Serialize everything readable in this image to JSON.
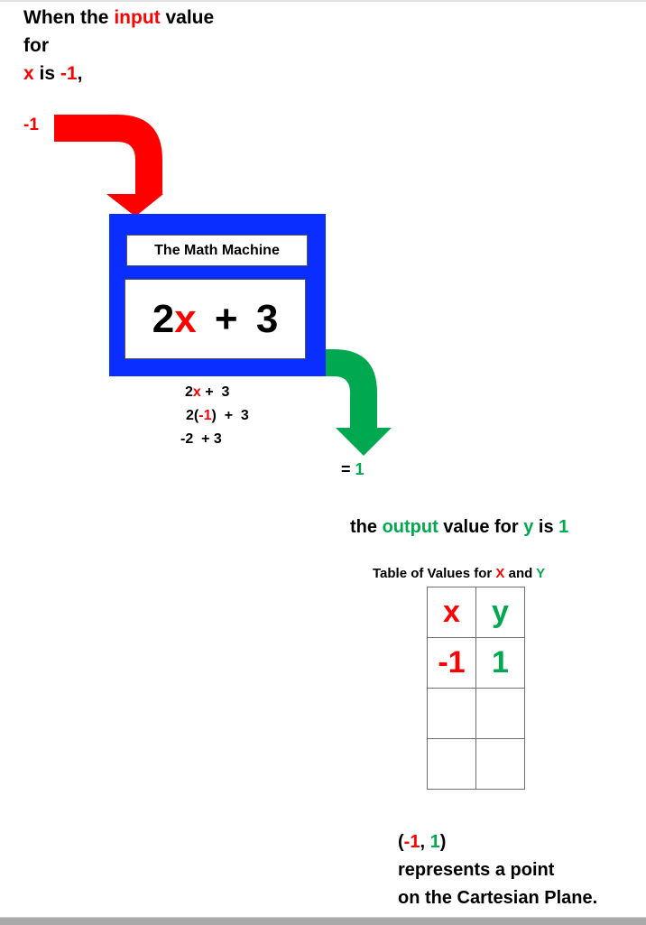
{
  "colors": {
    "input": "#ff0000",
    "output": "#00a84f",
    "machine": "#0a2eff"
  },
  "intro": {
    "line1_before": "When the ",
    "line1_highlight": "input",
    "line1_after": " value",
    "line2": "for",
    "line3_var": "x",
    "line3_mid": " is ",
    "line3_value": "-1",
    "line3_end": ","
  },
  "input_label": "-1",
  "machine": {
    "title": "The Math Machine",
    "expr_coef": "2",
    "expr_var": "x",
    "expr_rest": " + 3"
  },
  "steps": {
    "step1_coef": "2",
    "step1_var": "x",
    "step1_rest": " +  3",
    "step2_open": "2(",
    "step2_value": "-1",
    "step2_close": ")  +  3",
    "step3": "-2  + 3"
  },
  "result": {
    "equals": "= ",
    "value": "1"
  },
  "output_sentence": {
    "before": "the ",
    "highlight": "output",
    "middle": " value for ",
    "var": "y",
    "is": " is ",
    "value": "1"
  },
  "table": {
    "title_before": "Table of Values for ",
    "title_x": "X",
    "title_and": " and ",
    "title_y": "Y",
    "headers": [
      "x",
      "y"
    ],
    "rows": [
      [
        "-1",
        "1"
      ],
      [
        "",
        ""
      ],
      [
        "",
        ""
      ]
    ]
  },
  "point": {
    "open": "(",
    "x": "-1",
    "sep": ", ",
    "y": "1",
    "close": ")",
    "line2": "represents a point",
    "line3": "on the Cartesian Plane."
  }
}
